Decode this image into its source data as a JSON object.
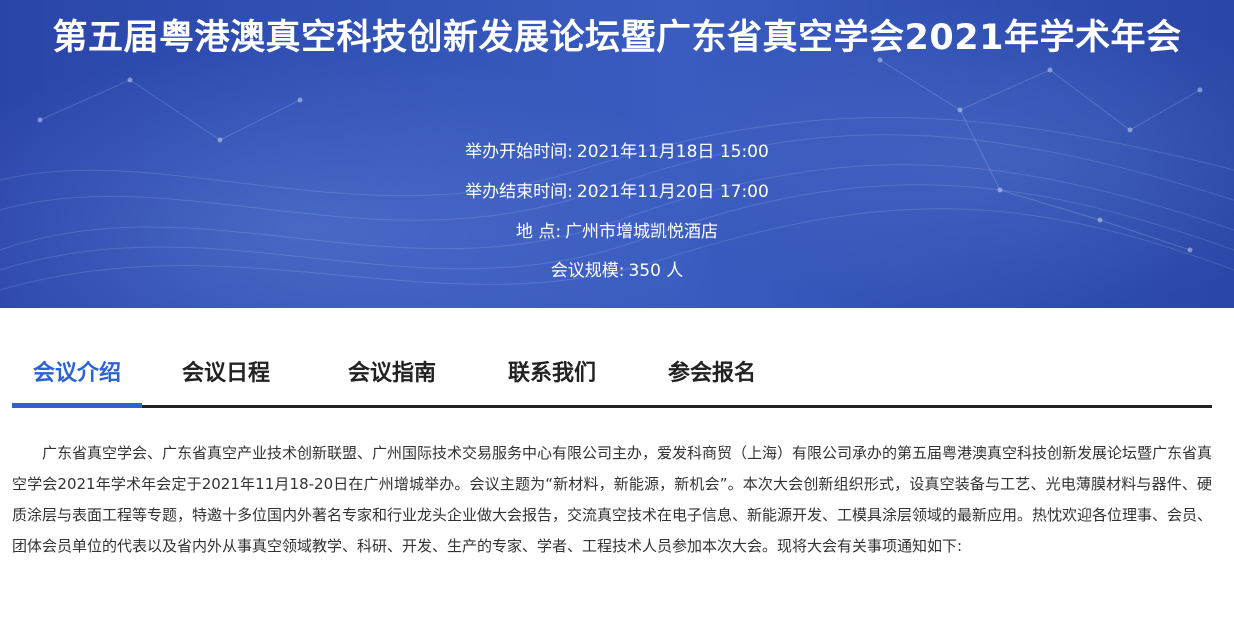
{
  "banner": {
    "title": "第五届粤港澳真空科技创新发展论坛暨广东省真空学会2021年学术年会",
    "start_label": "举办开始时间:",
    "start_value": "2021年11月18日 15:00",
    "end_label": "举办结束时间:",
    "end_value": "2021年11月20日 17:00",
    "location_label": "地 点:",
    "location_value": "广州市增城凯悦酒店",
    "scale_label": "会议规模:",
    "scale_value": "350 人"
  },
  "tabs": [
    {
      "label": "会议介绍",
      "active": true
    },
    {
      "label": "会议日程",
      "active": false
    },
    {
      "label": "会议指南",
      "active": false
    },
    {
      "label": "联系我们",
      "active": false
    },
    {
      "label": "参会报名",
      "active": false
    }
  ],
  "intro": {
    "text": "广东省真空学会、广东省真空产业技术创新联盟、广州国际技术交易服务中心有限公司主办，爱发科商贸（上海）有限公司承办的第五届粤港澳真空科技创新发展论坛暨广东省真空学会2021年学术年会定于2021年11月18-20日在广州增城举办。会议主题为“新材料，新能源，新机会”。本次大会创新组织形式，设真空装备与工艺、光电薄膜材料与器件、硬质涂层与表面工程等专题，特邀十多位国内外著名专家和行业龙头企业做大会报告，交流真空技术在电子信息、新能源开发、工模具涂层领域的最新应用。热忱欢迎各位理事、会员、团体会员单位的代表以及省内外从事真空领域教学、科研、开发、生产的专家、学者、工程技术人员参加本次大会。现将大会有关事项通知如下:"
  },
  "colors": {
    "banner_blue": "#3355b8",
    "accent_blue": "#2b63d6",
    "tab_text": "#222222"
  }
}
